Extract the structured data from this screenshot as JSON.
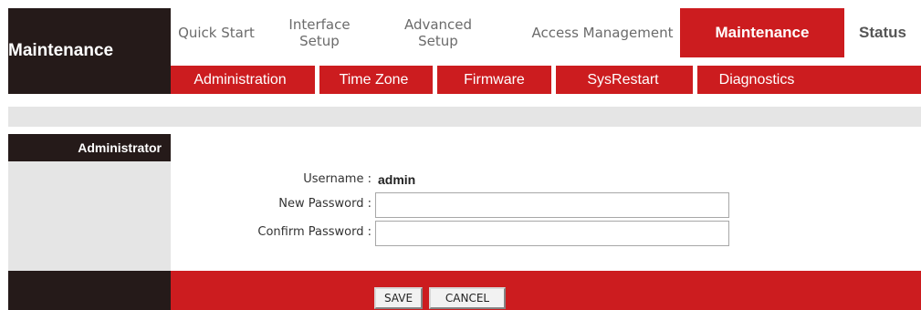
{
  "header": {
    "brand_title": "Maintenance",
    "nav": [
      {
        "label": "Quick Start"
      },
      {
        "label": "Interface Setup"
      },
      {
        "label": "Advanced Setup"
      },
      {
        "label": "Access Management"
      },
      {
        "label": "Maintenance"
      },
      {
        "label": "Status"
      }
    ],
    "active_nav": "Maintenance",
    "subnav": [
      {
        "label": "Administration"
      },
      {
        "label": "Time Zone"
      },
      {
        "label": "Firmware"
      },
      {
        "label": "SysRestart"
      },
      {
        "label": "Diagnostics"
      }
    ]
  },
  "section": {
    "label": "Administrator",
    "fields": {
      "username_label": "Username :",
      "username_value": "admin",
      "new_password_label": "New Password :",
      "new_password_value": "",
      "confirm_password_label": "Confirm Password :",
      "confirm_password_value": ""
    }
  },
  "buttons": {
    "save": "SAVE",
    "cancel": "CANCEL"
  },
  "colors": {
    "accent_red": "#cc1c1f",
    "dark": "#251a19",
    "light_gray": "#e5e5e5"
  }
}
